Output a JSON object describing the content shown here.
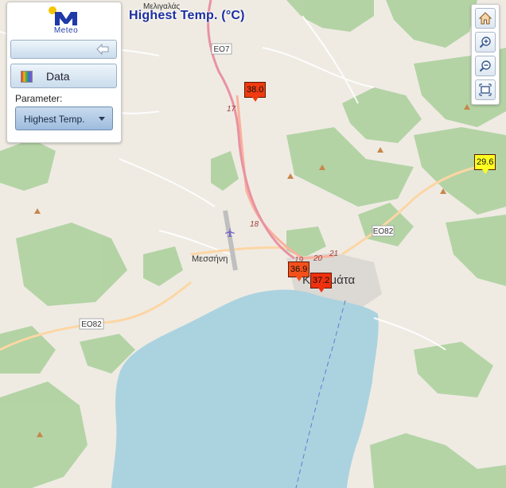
{
  "title": "Highest Temp. (°C)",
  "logo": {
    "text": "Meteo",
    "icon": "meteo-logo-icon"
  },
  "panel": {
    "collapse_icon": "back-arrow-icon",
    "data_button_label": "Data",
    "data_icon": "color-legend-icon",
    "parameter_label": "Parameter:",
    "parameter_selected": "Highest Temp.",
    "parameter_chevron_icon": "chevron-down-icon"
  },
  "toolbar": [
    {
      "name": "home-button",
      "icon": "home-icon"
    },
    {
      "name": "zoom-in-button",
      "icon": "zoom-in-icon"
    },
    {
      "name": "zoom-out-button",
      "icon": "zoom-out-icon"
    },
    {
      "name": "zoom-extent-button",
      "icon": "extent-icon"
    }
  ],
  "map": {
    "place_labels": {
      "meligalas": "Μελιγαλάς",
      "messini": "Μεσσήνη",
      "kalamata": "Καλαμάτα"
    },
    "road_shields": {
      "eo7": "ΕΟ7",
      "eo82_east": "ΕΟ82",
      "eo82_west": "ΕΟ82"
    },
    "road_numbers": {
      "n17": "17",
      "n18": "18",
      "n19": "19",
      "n20": "20",
      "n21": "21"
    },
    "airport_icon": "airplane-icon",
    "peak_icon": "peak-triangle-icon",
    "colors": {
      "sea": "#abd3df",
      "forest": "#add19e",
      "motorway": "#e892a2",
      "trunk": "#f9b29c",
      "primary": "#fcd6a4"
    }
  },
  "stations": [
    {
      "value": "38.0",
      "color": "#f03a0f"
    },
    {
      "value": "29.6",
      "color": "#ffff20"
    },
    {
      "value": "36.9",
      "color": "#f4511a"
    },
    {
      "value": "37.2",
      "color": "#f0300e"
    }
  ]
}
